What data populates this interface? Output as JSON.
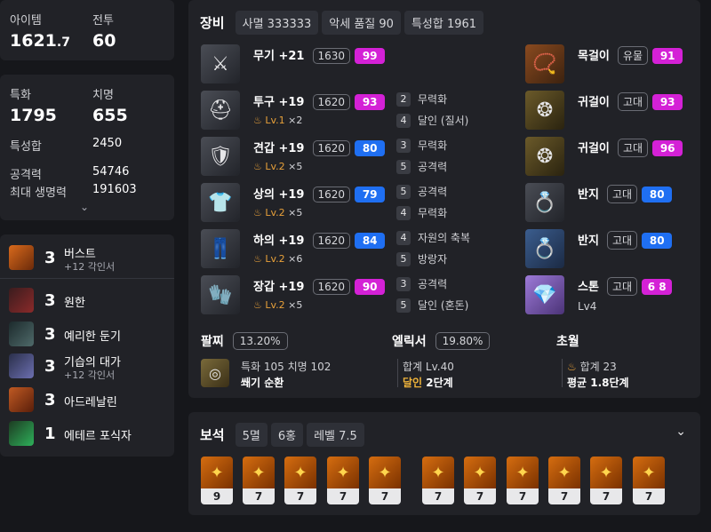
{
  "stats": {
    "item_label": "아이템",
    "item_value_int": "1621",
    "item_value_dec": ".7",
    "combat_label": "전투",
    "combat_value": "60"
  },
  "stats2": {
    "spec_label": "특화",
    "spec_value": "1795",
    "crit_label": "치명",
    "crit_value": "655",
    "statsum_label": "특성합",
    "statsum_value": "2450",
    "atk_label": "공격력",
    "atk_value": "54746",
    "hp_label": "최대 생명력",
    "hp_value": "191603"
  },
  "skills": [
    {
      "count": "3",
      "name": "버스트",
      "sub": "+12 각인서"
    },
    {
      "count": "3",
      "name": "원한",
      "sub": ""
    },
    {
      "count": "3",
      "name": "예리한 둔기",
      "sub": ""
    },
    {
      "count": "3",
      "name": "기습의 대가",
      "sub": "+12 각인서"
    },
    {
      "count": "3",
      "name": "아드레날린",
      "sub": ""
    },
    {
      "count": "1",
      "name": "에테르 포식자",
      "sub": ""
    }
  ],
  "equip": {
    "title": "장비",
    "chips": [
      "사멸 333333",
      "악세 품질 90",
      "특성합 1961"
    ],
    "items": [
      {
        "name": "무기 +21",
        "ilvl": "1630",
        "quality": "99",
        "qcolor": "pink",
        "tier": "",
        "xn": ""
      },
      {
        "name": "투구 +19",
        "ilvl": "1620",
        "quality": "93",
        "qcolor": "pink",
        "tier": "Lv.1",
        "xn": "×2"
      },
      {
        "name": "견갑 +19",
        "ilvl": "1620",
        "quality": "80",
        "qcolor": "blue",
        "tier": "Lv.2",
        "xn": "×5"
      },
      {
        "name": "상의 +19",
        "ilvl": "1620",
        "quality": "79",
        "qcolor": "blue",
        "tier": "Lv.2",
        "xn": "×5"
      },
      {
        "name": "하의 +19",
        "ilvl": "1620",
        "quality": "84",
        "qcolor": "blue",
        "tier": "Lv.2",
        "xn": "×6"
      },
      {
        "name": "장갑 +19",
        "ilvl": "1620",
        "quality": "90",
        "qcolor": "pink",
        "tier": "Lv.2",
        "xn": "×5"
      }
    ],
    "engravings": [
      {
        "n": "2",
        "t": "무력화"
      },
      {
        "n": "4",
        "t": "달인 (질서)"
      },
      {
        "n": "3",
        "t": "무력화"
      },
      {
        "n": "5",
        "t": "공격력"
      },
      {
        "n": "5",
        "t": "공격력"
      },
      {
        "n": "4",
        "t": "무력화"
      },
      {
        "n": "4",
        "t": "자원의 축복"
      },
      {
        "n": "5",
        "t": "방랑자"
      },
      {
        "n": "3",
        "t": "공격력"
      },
      {
        "n": "5",
        "t": "달인 (혼돈)"
      }
    ],
    "acc": [
      {
        "name": "목걸이",
        "grade": "유물",
        "quality": "91",
        "qcolor": "pink"
      },
      {
        "name": "귀걸이",
        "grade": "고대",
        "quality": "93",
        "qcolor": "pink"
      },
      {
        "name": "귀걸이",
        "grade": "고대",
        "quality": "96",
        "qcolor": "pink"
      },
      {
        "name": "반지",
        "grade": "고대",
        "quality": "80",
        "qcolor": "blue"
      },
      {
        "name": "반지",
        "grade": "고대",
        "quality": "80",
        "qcolor": "blue"
      },
      {
        "name": "스톤",
        "grade": "고대",
        "quality": "6 8",
        "qcolor": "pink",
        "sub": "Lv4"
      }
    ],
    "bracelet": {
      "title": "팔찌",
      "pct": "13.20%",
      "line1": "특화 105  치명 102",
      "line2": "쐐기  순환"
    },
    "elixir": {
      "title": "엘릭서",
      "pct": "19.80%",
      "line1": "합계 Lv.40",
      "line2a": "달인",
      "line2b": "2단계"
    },
    "transcend": {
      "title": "초월",
      "line1": "합계 23",
      "line2": "평균 1.8단계"
    }
  },
  "gems": {
    "title": "보석",
    "chips": [
      "5멸",
      "6홍",
      "레벨 7.5"
    ],
    "levels": [
      "9",
      "7",
      "7",
      "7",
      "7",
      "7",
      "7",
      "7",
      "7",
      "7",
      "7"
    ]
  },
  "colors": {
    "pink": "#d421d6",
    "blue": "#1f6ff2",
    "bg": "#16171b",
    "card": "#212227"
  }
}
